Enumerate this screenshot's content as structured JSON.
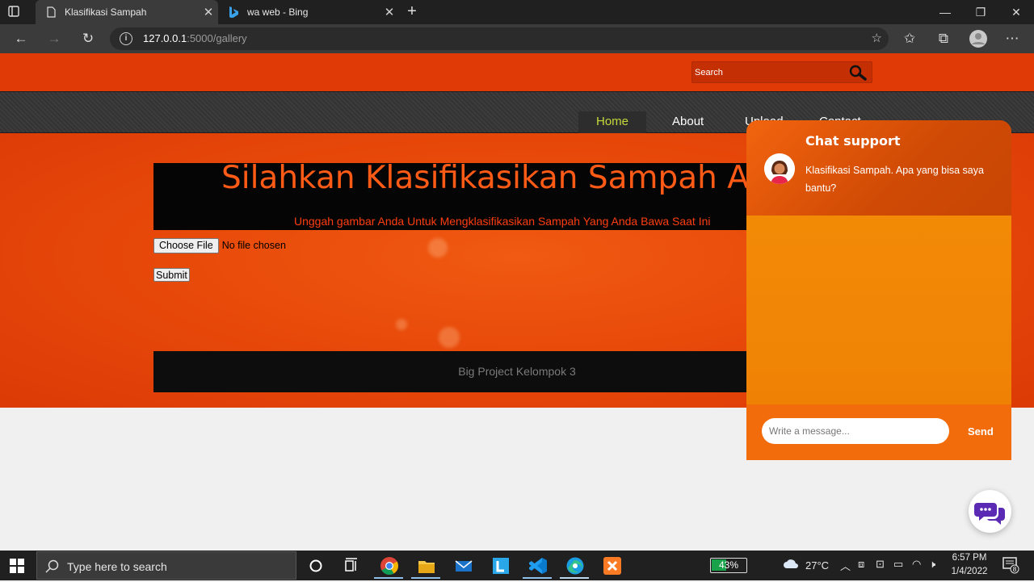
{
  "browser": {
    "tabs": [
      {
        "title": "Klasifikasi Sampah",
        "active": true
      },
      {
        "title": "wa web - Bing",
        "active": false
      }
    ],
    "address": {
      "host": "127.0.0.1",
      "path": ":5000/gallery"
    }
  },
  "site": {
    "search": {
      "placeholder": "Search"
    },
    "nav": {
      "home": "Home",
      "about": "About",
      "upload": "Upload",
      "contact": "Contact"
    },
    "title": "Silahkan Klasifikasikan Sampah Anda",
    "subtitle": "Unggah gambar Anda Untuk Mengklasifikasikan Sampah Yang Anda Bawa Saat Ini",
    "file_input": {
      "button": "Choose File",
      "status": "No file chosen"
    },
    "submit": "Submit",
    "footer": "Big Project Kelompok 3",
    "colors": {
      "primary": "#e84a0a",
      "title": "#ff5a16",
      "nav_active": "#c6d93a"
    }
  },
  "chat": {
    "title": "Chat support",
    "intro": "Klasifikasi Sampah. Apa yang bisa saya bantu?",
    "input_placeholder": "Write a message...",
    "send": "Send"
  },
  "taskbar": {
    "search_placeholder": "Type here to search",
    "battery": "43%",
    "battery_level": 0.43,
    "temperature": "27°C",
    "time": "6:57 PM",
    "date": "1/4/2022",
    "notifications": "8"
  }
}
